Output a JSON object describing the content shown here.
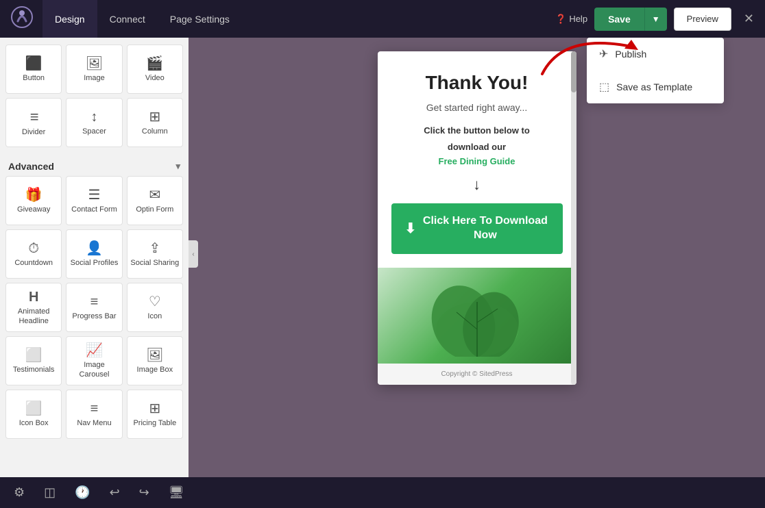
{
  "nav": {
    "tabs": [
      "Design",
      "Connect",
      "Page Settings"
    ],
    "active_tab": "Design",
    "help_label": "Help",
    "save_label": "Save",
    "preview_label": "Preview",
    "close_icon": "✕"
  },
  "dropdown": {
    "items": [
      {
        "id": "publish",
        "icon": "✈",
        "label": "Publish"
      },
      {
        "id": "save-template",
        "icon": "⬚",
        "label": "Save as Template"
      }
    ]
  },
  "sidebar": {
    "basic_items": [
      {
        "id": "button",
        "icon": "⬛",
        "label": "Button"
      },
      {
        "id": "image",
        "icon": "🖼",
        "label": "Image"
      },
      {
        "id": "video",
        "icon": "🎬",
        "label": "Video"
      },
      {
        "id": "divider",
        "icon": "≡",
        "label": "Divider"
      },
      {
        "id": "spacer",
        "icon": "↕",
        "label": "Spacer"
      },
      {
        "id": "column",
        "icon": "⊞",
        "label": "Column"
      }
    ],
    "advanced_label": "Advanced",
    "advanced_items": [
      {
        "id": "giveaway",
        "icon": "🎁",
        "label": "Giveaway"
      },
      {
        "id": "contact-form",
        "icon": "☰",
        "label": "Contact Form"
      },
      {
        "id": "optin-form",
        "icon": "✉",
        "label": "Optin Form"
      },
      {
        "id": "countdown",
        "icon": "⏱",
        "label": "Countdown"
      },
      {
        "id": "social-profiles",
        "icon": "👤",
        "label": "Social Profiles"
      },
      {
        "id": "social-sharing",
        "icon": "⇪",
        "label": "Social Sharing"
      },
      {
        "id": "animated-headline",
        "icon": "H",
        "label": "Animated Headline"
      },
      {
        "id": "progress-bar",
        "icon": "≡",
        "label": "Progress Bar"
      },
      {
        "id": "icon",
        "icon": "♡",
        "label": "Icon"
      },
      {
        "id": "testimonials",
        "icon": "⬜",
        "label": "Testimonials"
      },
      {
        "id": "image-carousel",
        "icon": "📈",
        "label": "Image Carousel"
      },
      {
        "id": "image-box",
        "icon": "🖼",
        "label": "Image Box"
      },
      {
        "id": "icon-box",
        "icon": "⬜",
        "label": "Icon Box"
      },
      {
        "id": "nav-menu",
        "icon": "≡",
        "label": "Nav Menu"
      },
      {
        "id": "pricing-table",
        "icon": "⊞",
        "label": "Pricing Table"
      }
    ]
  },
  "preview": {
    "title": "Thank You!",
    "subtitle": "Get started right away...",
    "body_line1": "Click the button below to",
    "body_line2": "download our",
    "link_text": "Free Dining Guide",
    "button_text": "Click Here To Download Now",
    "copyright": "Copyright © SitedPress"
  }
}
